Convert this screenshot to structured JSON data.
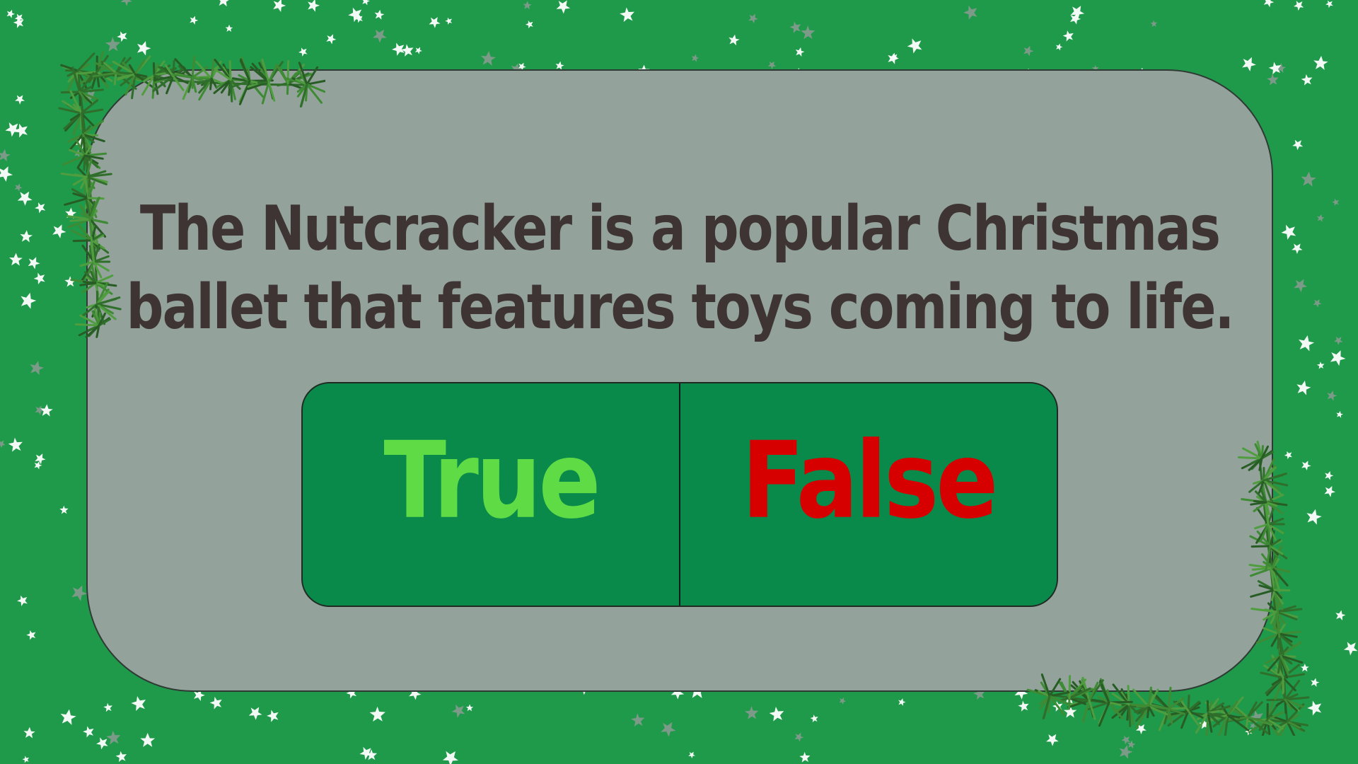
{
  "slide": {
    "question_lines": [
      "The Nutcracker is a popular Christmas",
      "ballet that features toys coming to life."
    ]
  },
  "answers": {
    "true_label": "True",
    "false_label": "False"
  },
  "colors": {
    "background": "#1e9a4a",
    "panel": "#93a39b",
    "question_text": "#3f3434",
    "answer_box": "#0a8a4a",
    "true_text": "#5fdc45",
    "false_text": "#d60000"
  },
  "decorations": {
    "top_left": "pine-garland-icon",
    "bottom_right": "pine-garland-icon",
    "background_pattern": "star-pattern-icon"
  }
}
